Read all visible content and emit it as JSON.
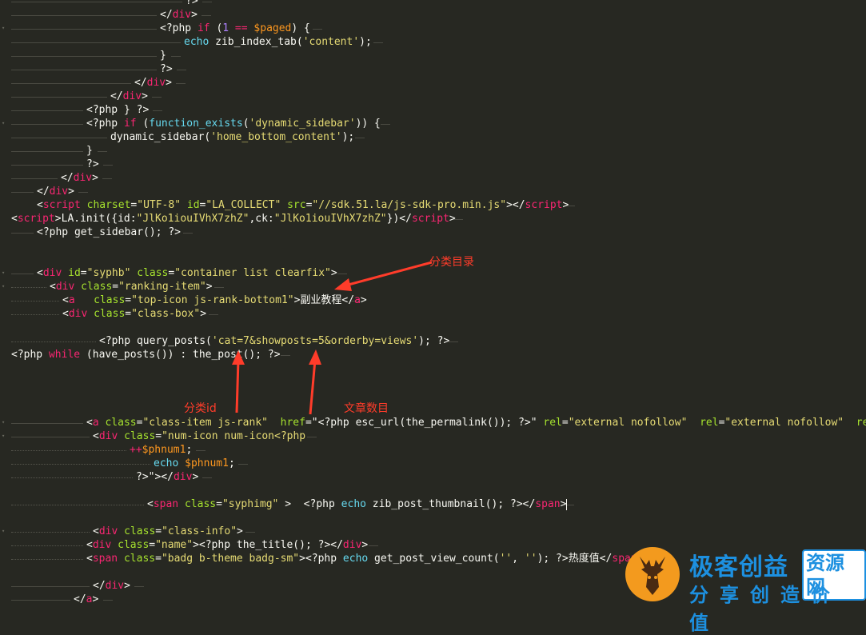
{
  "editor": {
    "lines": [
      {
        "tokens": [
          {
            "t": "?>",
            "c": "php"
          }
        ]
      },
      {
        "tokens": [
          {
            "t": "</",
            "c": "php"
          },
          {
            "t": "div",
            "c": "tag"
          },
          {
            "t": ">",
            "c": "php"
          }
        ]
      },
      {
        "tokens": [
          {
            "t": "<?php ",
            "c": "php"
          },
          {
            "t": "if",
            "c": "kw"
          },
          {
            "t": " (",
            "c": "php"
          },
          {
            "t": "1",
            "c": "num"
          },
          {
            "t": " == ",
            "c": "op"
          },
          {
            "t": "$paged",
            "c": "var"
          },
          {
            "t": ") {",
            "c": "php"
          }
        ]
      },
      {
        "tokens": [
          {
            "t": "echo",
            "c": "fn"
          },
          {
            "t": " zib_index_tab(",
            "c": "php"
          },
          {
            "t": "'content'",
            "c": "str"
          },
          {
            "t": ");",
            "c": "php"
          }
        ]
      },
      {
        "tokens": [
          {
            "t": "}",
            "c": "php"
          }
        ]
      },
      {
        "tokens": [
          {
            "t": "?>",
            "c": "php"
          }
        ]
      },
      {
        "tokens": [
          {
            "t": "</",
            "c": "php"
          },
          {
            "t": "div",
            "c": "tag"
          },
          {
            "t": ">",
            "c": "php"
          }
        ]
      },
      {
        "tokens": [
          {
            "t": "</",
            "c": "php"
          },
          {
            "t": "div",
            "c": "tag"
          },
          {
            "t": ">",
            "c": "php"
          }
        ]
      },
      {
        "tokens": [
          {
            "t": "<?php } ?>",
            "c": "php"
          }
        ]
      },
      {
        "tokens": [
          {
            "t": "<?php ",
            "c": "php"
          },
          {
            "t": "if",
            "c": "kw"
          },
          {
            "t": " (",
            "c": "php"
          },
          {
            "t": "function_exists",
            "c": "fn"
          },
          {
            "t": "(",
            "c": "php"
          },
          {
            "t": "'dynamic_sidebar'",
            "c": "str"
          },
          {
            "t": ")) {",
            "c": "php"
          }
        ]
      },
      {
        "tokens": [
          {
            "t": "dynamic_sidebar(",
            "c": "php"
          },
          {
            "t": "'home_bottom_content'",
            "c": "str"
          },
          {
            "t": ");",
            "c": "php"
          }
        ]
      },
      {
        "tokens": [
          {
            "t": "}",
            "c": "php"
          }
        ]
      },
      {
        "tokens": [
          {
            "t": "?>",
            "c": "php"
          }
        ]
      },
      {
        "tokens": [
          {
            "t": "</",
            "c": "php"
          },
          {
            "t": "div",
            "c": "tag"
          },
          {
            "t": ">",
            "c": "php"
          }
        ]
      },
      {
        "tokens": [
          {
            "t": "</",
            "c": "php"
          },
          {
            "t": "div",
            "c": "tag"
          },
          {
            "t": ">",
            "c": "php"
          }
        ]
      },
      {
        "tokens": [
          {
            "t": "<",
            "c": "php"
          },
          {
            "t": "script",
            "c": "tag"
          },
          {
            "t": " ",
            "c": "php"
          },
          {
            "t": "charset",
            "c": "attr"
          },
          {
            "t": "=",
            "c": "php"
          },
          {
            "t": "\"UTF-8\"",
            "c": "str"
          },
          {
            "t": " ",
            "c": "php"
          },
          {
            "t": "id",
            "c": "attr"
          },
          {
            "t": "=",
            "c": "php"
          },
          {
            "t": "\"LA_COLLECT\"",
            "c": "str"
          },
          {
            "t": " ",
            "c": "php"
          },
          {
            "t": "src",
            "c": "attr"
          },
          {
            "t": "=",
            "c": "php"
          },
          {
            "t": "\"//sdk.51.la/js-sdk-pro.min.js\"",
            "c": "str"
          },
          {
            "t": "></",
            "c": "php"
          },
          {
            "t": "script",
            "c": "tag"
          },
          {
            "t": ">",
            "c": "php"
          }
        ]
      },
      {
        "tokens": [
          {
            "t": "<",
            "c": "php"
          },
          {
            "t": "script",
            "c": "tag"
          },
          {
            "t": ">LA.init({id:",
            "c": "php"
          },
          {
            "t": "\"JlKo1iouIVhX7zhZ\"",
            "c": "str"
          },
          {
            "t": ",ck:",
            "c": "php"
          },
          {
            "t": "\"JlKo1iouIVhX7zhZ\"",
            "c": "str"
          },
          {
            "t": "})</",
            "c": "php"
          },
          {
            "t": "script",
            "c": "tag"
          },
          {
            "t": ">",
            "c": "php"
          }
        ]
      },
      {
        "tokens": [
          {
            "t": "<?php get_sidebar(); ?>",
            "c": "php"
          }
        ]
      },
      {
        "tokens": []
      },
      {
        "tokens": []
      },
      {
        "tokens": [
          {
            "t": "<",
            "c": "php"
          },
          {
            "t": "div",
            "c": "tag"
          },
          {
            "t": " ",
            "c": "php"
          },
          {
            "t": "id",
            "c": "attr"
          },
          {
            "t": "=",
            "c": "php"
          },
          {
            "t": "\"syphb\"",
            "c": "str"
          },
          {
            "t": " ",
            "c": "php"
          },
          {
            "t": "class",
            "c": "attr"
          },
          {
            "t": "=",
            "c": "php"
          },
          {
            "t": "\"container list clearfix\"",
            "c": "str"
          },
          {
            "t": ">",
            "c": "php"
          }
        ]
      },
      {
        "tokens": [
          {
            "t": "<",
            "c": "php"
          },
          {
            "t": "div",
            "c": "tag"
          },
          {
            "t": " ",
            "c": "php"
          },
          {
            "t": "class",
            "c": "attr"
          },
          {
            "t": "=",
            "c": "php"
          },
          {
            "t": "\"ranking-item\"",
            "c": "str"
          },
          {
            "t": ">",
            "c": "php"
          }
        ]
      },
      {
        "tokens": [
          {
            "t": "<",
            "c": "php"
          },
          {
            "t": "a",
            "c": "tag"
          },
          {
            "t": "   ",
            "c": "php"
          },
          {
            "t": "class",
            "c": "attr"
          },
          {
            "t": "=",
            "c": "php"
          },
          {
            "t": "\"top-icon js-rank-bottom1\"",
            "c": "str"
          },
          {
            "t": ">副业教程</",
            "c": "text"
          },
          {
            "t": "a",
            "c": "tag"
          },
          {
            "t": ">",
            "c": "php"
          }
        ]
      },
      {
        "tokens": [
          {
            "t": "<",
            "c": "php"
          },
          {
            "t": "div",
            "c": "tag"
          },
          {
            "t": " ",
            "c": "php"
          },
          {
            "t": "class",
            "c": "attr"
          },
          {
            "t": "=",
            "c": "php"
          },
          {
            "t": "\"class-box\"",
            "c": "str"
          },
          {
            "t": ">",
            "c": "php"
          }
        ]
      },
      {
        "tokens": []
      },
      {
        "tokens": [
          {
            "t": "<?php query_posts(",
            "c": "php"
          },
          {
            "t": "'cat=7&showposts=5&orderby=views'",
            "c": "str"
          },
          {
            "t": "); ?>",
            "c": "php"
          }
        ]
      },
      {
        "tokens": [
          {
            "t": "<?php ",
            "c": "php"
          },
          {
            "t": "while",
            "c": "kw"
          },
          {
            "t": " (have_posts()) : the_post(); ?>",
            "c": "php"
          }
        ]
      },
      {
        "tokens": []
      },
      {
        "tokens": []
      },
      {
        "tokens": []
      },
      {
        "tokens": []
      },
      {
        "tokens": [
          {
            "t": "<",
            "c": "php"
          },
          {
            "t": "a",
            "c": "tag"
          },
          {
            "t": " ",
            "c": "php"
          },
          {
            "t": "class",
            "c": "attr"
          },
          {
            "t": "=",
            "c": "php"
          },
          {
            "t": "\"class-item js-rank\"",
            "c": "str"
          },
          {
            "t": "  ",
            "c": "php"
          },
          {
            "t": "href",
            "c": "attr"
          },
          {
            "t": "=\"<?php esc_url(the_permalink()); ?>\" ",
            "c": "php"
          },
          {
            "t": "rel",
            "c": "attr"
          },
          {
            "t": "=",
            "c": "php"
          },
          {
            "t": "\"external nofollow\"",
            "c": "str"
          },
          {
            "t": "  ",
            "c": "php"
          },
          {
            "t": "rel",
            "c": "attr"
          },
          {
            "t": "=",
            "c": "php"
          },
          {
            "t": "\"external nofollow\"",
            "c": "str"
          },
          {
            "t": "  ",
            "c": "php"
          },
          {
            "t": "rel",
            "c": "attr"
          },
          {
            "t": "=\"",
            "c": "php"
          }
        ]
      },
      {
        "tokens": [
          {
            "t": "<",
            "c": "php"
          },
          {
            "t": "div",
            "c": "tag"
          },
          {
            "t": " ",
            "c": "php"
          },
          {
            "t": "class",
            "c": "attr"
          },
          {
            "t": "=",
            "c": "php"
          },
          {
            "t": "\"num-icon num-icon<?php",
            "c": "str"
          }
        ]
      },
      {
        "tokens": [
          {
            "t": "++",
            "c": "op"
          },
          {
            "t": "$phnum1",
            "c": "var"
          },
          {
            "t": ";",
            "c": "php"
          }
        ]
      },
      {
        "tokens": [
          {
            "t": "echo",
            "c": "fn"
          },
          {
            "t": " ",
            "c": "php"
          },
          {
            "t": "$phnum1",
            "c": "var"
          },
          {
            "t": ";",
            "c": "php"
          }
        ]
      },
      {
        "tokens": [
          {
            "t": "?>\"></",
            "c": "php"
          },
          {
            "t": "div",
            "c": "tag"
          },
          {
            "t": ">",
            "c": "php"
          }
        ]
      },
      {
        "tokens": []
      },
      {
        "tokens": [
          {
            "t": "<",
            "c": "php"
          },
          {
            "t": "span",
            "c": "tag"
          },
          {
            "t": " ",
            "c": "php"
          },
          {
            "t": "class",
            "c": "attr"
          },
          {
            "t": "=",
            "c": "php"
          },
          {
            "t": "\"syphimg\"",
            "c": "str"
          },
          {
            "t": " >  <?php ",
            "c": "php"
          },
          {
            "t": "echo",
            "c": "fn"
          },
          {
            "t": " zib_post_thumbnail(); ?></",
            "c": "php"
          },
          {
            "t": "span",
            "c": "tag"
          },
          {
            "t": ">",
            "c": "php"
          }
        ]
      },
      {
        "tokens": []
      },
      {
        "tokens": [
          {
            "t": "<",
            "c": "php"
          },
          {
            "t": "div",
            "c": "tag"
          },
          {
            "t": " ",
            "c": "php"
          },
          {
            "t": "class",
            "c": "attr"
          },
          {
            "t": "=",
            "c": "php"
          },
          {
            "t": "\"class-info\"",
            "c": "str"
          },
          {
            "t": ">",
            "c": "php"
          }
        ]
      },
      {
        "tokens": [
          {
            "t": "<",
            "c": "php"
          },
          {
            "t": "div",
            "c": "tag"
          },
          {
            "t": " ",
            "c": "php"
          },
          {
            "t": "class",
            "c": "attr"
          },
          {
            "t": "=",
            "c": "php"
          },
          {
            "t": "\"name\"",
            "c": "str"
          },
          {
            "t": "><?php the_title(); ?></",
            "c": "php"
          },
          {
            "t": "div",
            "c": "tag"
          },
          {
            "t": ">",
            "c": "php"
          }
        ]
      },
      {
        "tokens": [
          {
            "t": "<",
            "c": "php"
          },
          {
            "t": "span",
            "c": "tag"
          },
          {
            "t": " ",
            "c": "php"
          },
          {
            "t": "class",
            "c": "attr"
          },
          {
            "t": "=",
            "c": "php"
          },
          {
            "t": "\"badg b-theme badg-sm\"",
            "c": "str"
          },
          {
            "t": "><?php ",
            "c": "php"
          },
          {
            "t": "echo",
            "c": "fn"
          },
          {
            "t": " get_post_view_count(",
            "c": "php"
          },
          {
            "t": "''",
            "c": "str"
          },
          {
            "t": ", ",
            "c": "php"
          },
          {
            "t": "''",
            "c": "str"
          },
          {
            "t": "); ?>热度值</",
            "c": "php"
          },
          {
            "t": "span",
            "c": "tag"
          },
          {
            "t": ">",
            "c": "php"
          }
        ]
      },
      {
        "tokens": []
      },
      {
        "tokens": [
          {
            "t": "</",
            "c": "php"
          },
          {
            "t": "div",
            "c": "tag"
          },
          {
            "t": ">",
            "c": "php"
          }
        ]
      },
      {
        "tokens": [
          {
            "t": "</",
            "c": "php"
          },
          {
            "t": "a",
            "c": "tag"
          },
          {
            "t": ">",
            "c": "php"
          }
        ]
      }
    ]
  },
  "annotations": {
    "category_directory": "分类目录",
    "category_id": "分类id",
    "article_count": "文章数目"
  },
  "watermark": {
    "title": "极客创益",
    "badge": "资源网",
    "slogan": "分享创造价值"
  },
  "colors": {
    "background": "#272822",
    "annotation": "#ff3c2a",
    "watermark_blue": "#1d90e0",
    "logo_orange": "#f39a1e"
  },
  "icons": {
    "logo": "deer-head-icon",
    "fold": "fold-triangle-icon"
  }
}
